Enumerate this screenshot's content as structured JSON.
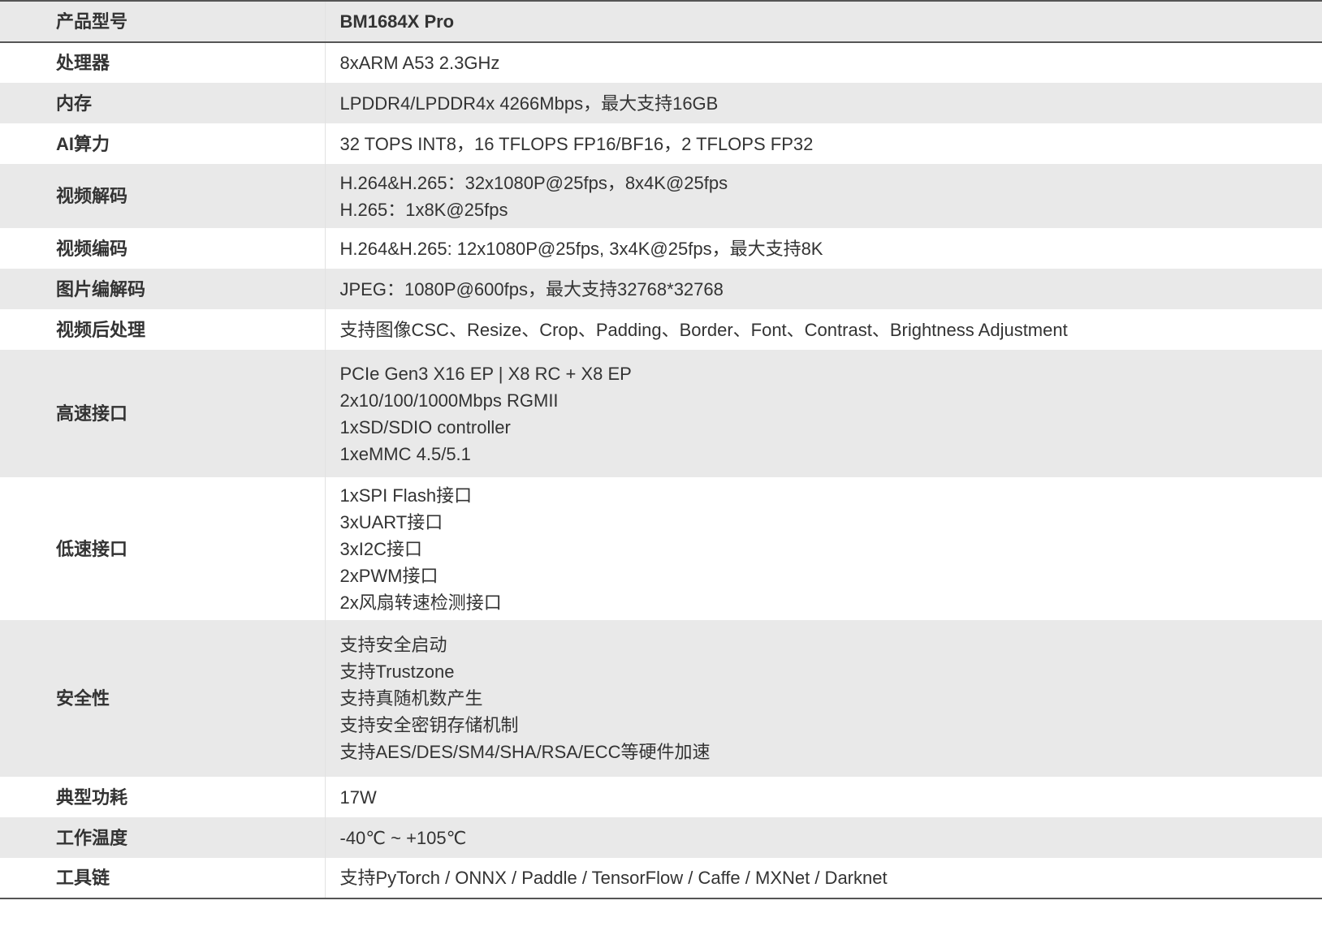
{
  "table": {
    "header": {
      "label": "产品型号",
      "value": "BM1684X Pro"
    },
    "rows": [
      {
        "label": "处理器",
        "lines": [
          "8xARM A53 2.3GHz"
        ]
      },
      {
        "label": "内存",
        "lines": [
          "LPDDR4/LPDDR4x 4266Mbps，最大支持16GB"
        ]
      },
      {
        "label": "AI算力",
        "lines": [
          "32 TOPS INT8，16 TFLOPS FP16/BF16，2 TFLOPS FP32"
        ]
      },
      {
        "label": "视频解码",
        "lines": [
          "H.264&H.265：32x1080P@25fps，8x4K@25fps",
          "H.265：1x8K@25fps"
        ]
      },
      {
        "label": "视频编码",
        "lines": [
          "H.264&H.265: 12x1080P@25fps, 3x4K@25fps，最大支持8K"
        ]
      },
      {
        "label": "图片编解码",
        "lines": [
          "JPEG：1080P@600fps，最大支持32768*32768"
        ]
      },
      {
        "label": "视频后处理",
        "lines": [
          "支持图像CSC、Resize、Crop、Padding、Border、Font、Contrast、Brightness Adjustment"
        ]
      },
      {
        "label": "高速接口",
        "lines": [
          "PCIe Gen3 X16 EP | X8 RC + X8 EP",
          "2x10/100/1000Mbps RGMII",
          "1xSD/SDIO controller",
          "1xeMMC 4.5/5.1"
        ]
      },
      {
        "label": "低速接口",
        "lines": [
          "1xSPI Flash接口",
          "3xUART接口",
          "3xI2C接口",
          "2xPWM接口",
          "2x风扇转速检测接口"
        ]
      },
      {
        "label": "安全性",
        "lines": [
          "支持安全启动",
          "支持Trustzone",
          "支持真随机数产生",
          "支持安全密钥存储机制",
          "支持AES/DES/SM4/SHA/RSA/ECC等硬件加速"
        ]
      },
      {
        "label": "典型功耗",
        "lines": [
          "17W"
        ]
      },
      {
        "label": "工作温度",
        "lines": [
          "-40℃ ~ +105℃"
        ]
      },
      {
        "label": "工具链",
        "lines": [
          "支持PyTorch / ONNX / Paddle / TensorFlow / Caffe / MXNet / Darknet"
        ]
      }
    ]
  }
}
